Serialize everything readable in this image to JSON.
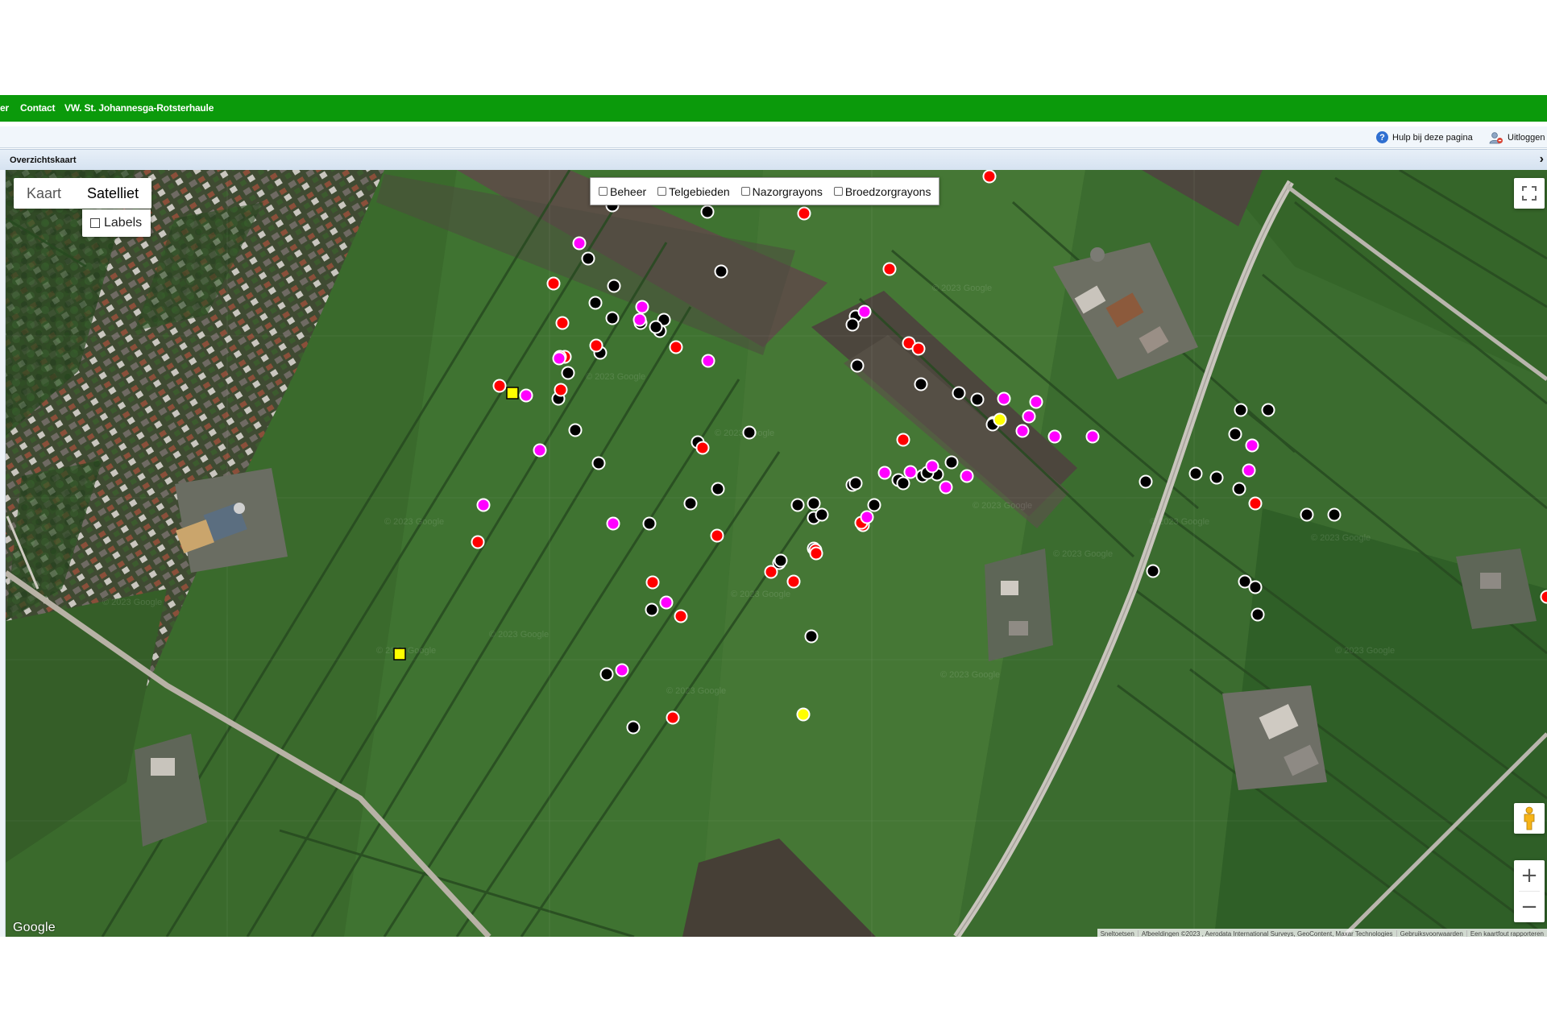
{
  "nav": {
    "items": [
      "er",
      "Contact",
      "VW. St. Johannesga-Rotsterhaule"
    ],
    "color": "#0b9a0b"
  },
  "toolbar": {
    "help_label": "Hulp bij deze pagina",
    "logout_label": "Uitloggen"
  },
  "panel": {
    "title": "Overzichtskaart"
  },
  "map": {
    "type_buttons": [
      {
        "label": "Kaart",
        "active": false
      },
      {
        "label": "Satelliet",
        "active": true
      }
    ],
    "labels_checkbox": {
      "label": "Labels",
      "checked": false
    },
    "layer_checkboxes": [
      {
        "label": "Beheer",
        "checked": false
      },
      {
        "label": "Telgebieden",
        "checked": false
      },
      {
        "label": "Nazorgrayons",
        "checked": false
      },
      {
        "label": "Broedzorgrayons",
        "checked": false
      }
    ],
    "google_logo": "Google",
    "attribution": [
      "Sneltoetsen",
      "Afbeeldingen ©2023 , Aerodata International Surveys, GeoContent, Maxar Technologies",
      "Gebruiksvoorwaarden",
      "Een kaartfout rapporteren"
    ],
    "imagery_watermark": "© 2023 Google",
    "marker_colors": {
      "black": "#000000",
      "red": "#ff0000",
      "magenta": "#ff00ff",
      "yellow": "#ffff00",
      "outline": "#ffffff"
    },
    "marker_counts": {
      "black": 62,
      "red": 28,
      "magenta": 26,
      "yellow": 2,
      "yellow_square": 2
    }
  }
}
